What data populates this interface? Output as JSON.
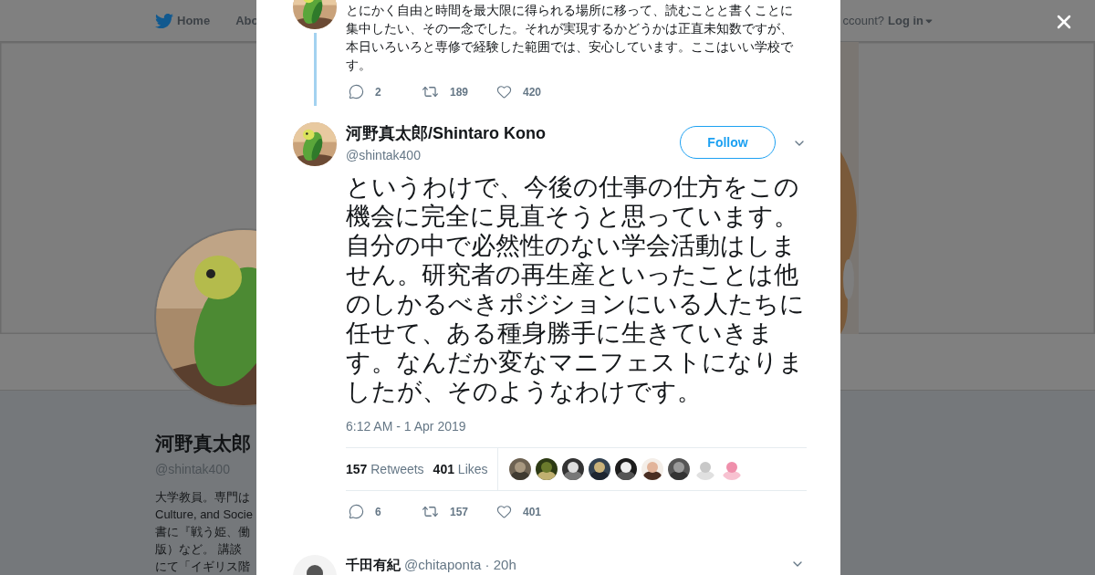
{
  "background_page": {
    "nav": [
      {
        "label": "Home"
      },
      {
        "label": "Abo"
      }
    ],
    "login_prompt": "ccount?",
    "login_link": "Log in",
    "profile": {
      "name": "河野真太郎",
      "handle": "@shintak400",
      "bio_lines": [
        "大学教員。専門は",
        "Culture, and Socie",
        "書に『戦う姫、働",
        "版）など。 講談",
        "にて「イギリス階"
      ]
    }
  },
  "previous_tweet": {
    "text": "とにかく自由と時間を最大限に得られる場所に移って、読むことと書くことに集中したい、その一念でした。それが実現するかどうかは正直未知数ですが、本日いろいろと専修で経験した範囲では、安心しています。ここはいい学校です。",
    "reply_count": "2",
    "retweet_count": "189",
    "like_count": "420"
  },
  "main_tweet": {
    "name": "河野真太郎/Shintaro Kono",
    "handle": "@shintak400",
    "follow_label": "Follow",
    "text": "というわけで、今後の仕事の仕方をこの機会に完全に見直そうと思っています。自分の中で必然性のない学会活動はしません。研究者の再生産といったことは他のしかるべきポジションにいる人たちに任せて、ある種身勝手に生きていきます。なんだか変なマニフェストになりましたが、そのようなわけです。",
    "timestamp": "6:12 AM - 1 Apr 2019",
    "retweets": {
      "count": "157",
      "label": "Retweets"
    },
    "likes": {
      "count": "401",
      "label": "Likes"
    },
    "reply_count": "6",
    "retweet_count": "157",
    "like_count": "401"
  },
  "reply_tweet": {
    "name": "千田有紀",
    "meta": "@chitaponta · 20h"
  }
}
